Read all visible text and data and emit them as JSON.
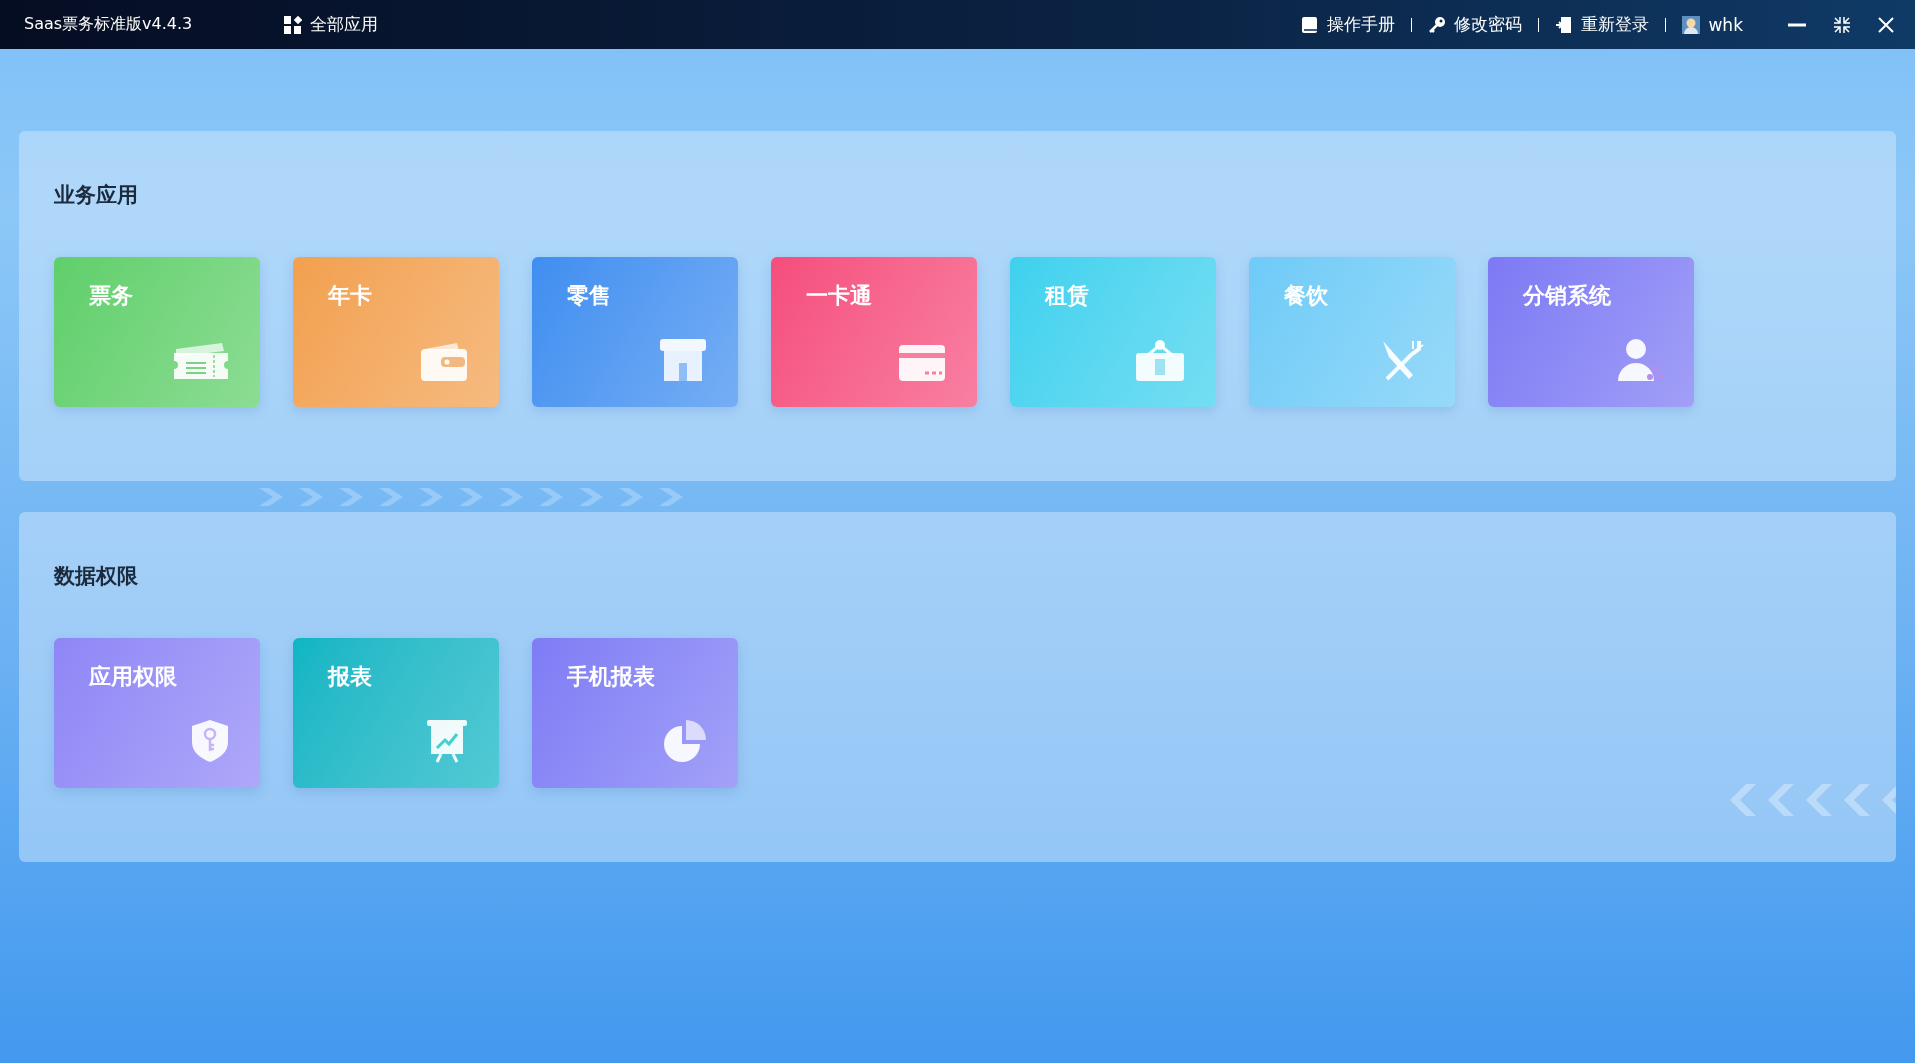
{
  "title_bar": {
    "app_title": "Saas票务标准版v4.4.3",
    "all_apps": "全部应用",
    "actions": [
      {
        "kind": "manual",
        "label": "操作手册"
      },
      {
        "kind": "password",
        "label": "修改密码"
      },
      {
        "kind": "relogin",
        "label": "重新登录"
      },
      {
        "kind": "user",
        "label": "whk"
      }
    ]
  },
  "sections": [
    {
      "title": "业务应用",
      "tiles": [
        {
          "label": "票务",
          "kind": "ticket",
          "color": "#5fcf6a"
        },
        {
          "label": "年卡",
          "kind": "wallet",
          "color": "#f2a04e"
        },
        {
          "label": "零售",
          "kind": "store",
          "color": "#3f8ef0"
        },
        {
          "label": "一卡通",
          "kind": "card",
          "color": "#f54d7c"
        },
        {
          "label": "租赁",
          "kind": "rent",
          "color": "#3dd1ee"
        },
        {
          "label": "餐饮",
          "kind": "dining",
          "color": "#6ecbf7"
        },
        {
          "label": "分销系统",
          "kind": "distribution",
          "color": "#7d79f4"
        }
      ]
    },
    {
      "title": "数据权限",
      "tiles": [
        {
          "label": "应用权限",
          "kind": "permission",
          "color": "#8f86f6"
        },
        {
          "label": "报表",
          "kind": "report",
          "color": "#0db5c4"
        },
        {
          "label": "手机报表",
          "kind": "mobile_report",
          "color": "#7f7cf5"
        }
      ]
    }
  ]
}
